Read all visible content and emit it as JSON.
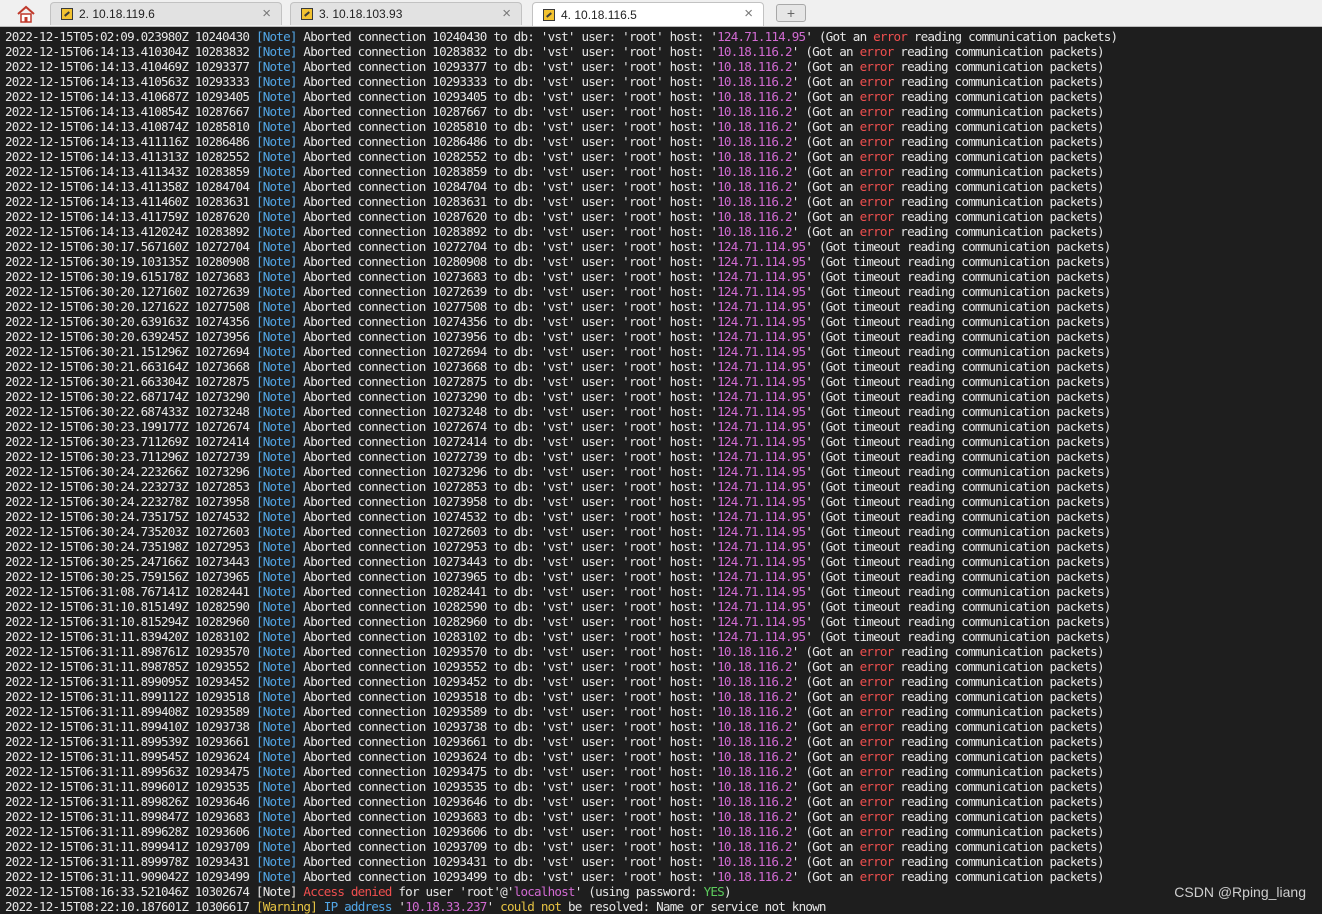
{
  "tabs": [
    {
      "label": "2. 10.18.119.6",
      "active": false
    },
    {
      "label": "3. 10.18.103.93",
      "active": false
    },
    {
      "label": "4. 10.18.116.5",
      "active": true
    }
  ],
  "tab_close_glyph": "×",
  "new_tab_glyph": "+",
  "icons": {
    "home": "home-icon",
    "session": "terminal-session-icon",
    "new_tab": "plus-icon"
  },
  "colors": {
    "background": "#1e1e1e",
    "text": "#e6e6e6",
    "note": "#52a7e8",
    "host": "#d16ad2",
    "error": "#ef4f4f",
    "warning": "#e6c343",
    "yes": "#5ccc5c"
  },
  "log": [
    [
      "2022-12-15T05:02:09.023980Z 10240430 ",
      [
        "n",
        "[Note]"
      ],
      " Aborted connection 10240430 to db: 'vst' user: 'root' host: '",
      [
        "h",
        "124.71.114.95"
      ],
      "' (Got an ",
      [
        "e",
        "error"
      ],
      " reading communication packets)"
    ],
    [
      "2022-12-15T06:14:13.410304Z 10283832 ",
      [
        "n",
        "[Note]"
      ],
      " Aborted connection 10283832 to db: 'vst' user: 'root' host: '",
      [
        "h",
        "10.18.116.2"
      ],
      "' (Got an ",
      [
        "e",
        "error"
      ],
      " reading communication packets)"
    ],
    [
      "2022-12-15T06:14:13.410469Z 10293377 ",
      [
        "n",
        "[Note]"
      ],
      " Aborted connection 10293377 to db: 'vst' user: 'root' host: '",
      [
        "h",
        "10.18.116.2"
      ],
      "' (Got an ",
      [
        "e",
        "error"
      ],
      " reading communication packets)"
    ],
    [
      "2022-12-15T06:14:13.410563Z 10293333 ",
      [
        "n",
        "[Note]"
      ],
      " Aborted connection 10293333 to db: 'vst' user: 'root' host: '",
      [
        "h",
        "10.18.116.2"
      ],
      "' (Got an ",
      [
        "e",
        "error"
      ],
      " reading communication packets)"
    ],
    [
      "2022-12-15T06:14:13.410687Z 10293405 ",
      [
        "n",
        "[Note]"
      ],
      " Aborted connection 10293405 to db: 'vst' user: 'root' host: '",
      [
        "h",
        "10.18.116.2"
      ],
      "' (Got an ",
      [
        "e",
        "error"
      ],
      " reading communication packets)"
    ],
    [
      "2022-12-15T06:14:13.410854Z 10287667 ",
      [
        "n",
        "[Note]"
      ],
      " Aborted connection 10287667 to db: 'vst' user: 'root' host: '",
      [
        "h",
        "10.18.116.2"
      ],
      "' (Got an ",
      [
        "e",
        "error"
      ],
      " reading communication packets)"
    ],
    [
      "2022-12-15T06:14:13.410874Z 10285810 ",
      [
        "n",
        "[Note]"
      ],
      " Aborted connection 10285810 to db: 'vst' user: 'root' host: '",
      [
        "h",
        "10.18.116.2"
      ],
      "' (Got an ",
      [
        "e",
        "error"
      ],
      " reading communication packets)"
    ],
    [
      "2022-12-15T06:14:13.411116Z 10286486 ",
      [
        "n",
        "[Note]"
      ],
      " Aborted connection 10286486 to db: 'vst' user: 'root' host: '",
      [
        "h",
        "10.18.116.2"
      ],
      "' (Got an ",
      [
        "e",
        "error"
      ],
      " reading communication packets)"
    ],
    [
      "2022-12-15T06:14:13.411313Z 10282552 ",
      [
        "n",
        "[Note]"
      ],
      " Aborted connection 10282552 to db: 'vst' user: 'root' host: '",
      [
        "h",
        "10.18.116.2"
      ],
      "' (Got an ",
      [
        "e",
        "error"
      ],
      " reading communication packets)"
    ],
    [
      "2022-12-15T06:14:13.411343Z 10283859 ",
      [
        "n",
        "[Note]"
      ],
      " Aborted connection 10283859 to db: 'vst' user: 'root' host: '",
      [
        "h",
        "10.18.116.2"
      ],
      "' (Got an ",
      [
        "e",
        "error"
      ],
      " reading communication packets)"
    ],
    [
      "2022-12-15T06:14:13.411358Z 10284704 ",
      [
        "n",
        "[Note]"
      ],
      " Aborted connection 10284704 to db: 'vst' user: 'root' host: '",
      [
        "h",
        "10.18.116.2"
      ],
      "' (Got an ",
      [
        "e",
        "error"
      ],
      " reading communication packets)"
    ],
    [
      "2022-12-15T06:14:13.411460Z 10283631 ",
      [
        "n",
        "[Note]"
      ],
      " Aborted connection 10283631 to db: 'vst' user: 'root' host: '",
      [
        "h",
        "10.18.116.2"
      ],
      "' (Got an ",
      [
        "e",
        "error"
      ],
      " reading communication packets)"
    ],
    [
      "2022-12-15T06:14:13.411759Z 10287620 ",
      [
        "n",
        "[Note]"
      ],
      " Aborted connection 10287620 to db: 'vst' user: 'root' host: '",
      [
        "h",
        "10.18.116.2"
      ],
      "' (Got an ",
      [
        "e",
        "error"
      ],
      " reading communication packets)"
    ],
    [
      "2022-12-15T06:14:13.412024Z 10283892 ",
      [
        "n",
        "[Note]"
      ],
      " Aborted connection 10283892 to db: 'vst' user: 'root' host: '",
      [
        "h",
        "10.18.116.2"
      ],
      "' (Got an ",
      [
        "e",
        "error"
      ],
      " reading communication packets)"
    ],
    [
      "2022-12-15T06:30:17.567160Z 10272704 ",
      [
        "n",
        "[Note]"
      ],
      " Aborted connection 10272704 to db: 'vst' user: 'root' host: '",
      [
        "h",
        "124.71.114.95"
      ],
      "' (Got timeout reading communication packets)"
    ],
    [
      "2022-12-15T06:30:19.103135Z 10280908 ",
      [
        "n",
        "[Note]"
      ],
      " Aborted connection 10280908 to db: 'vst' user: 'root' host: '",
      [
        "h",
        "124.71.114.95"
      ],
      "' (Got timeout reading communication packets)"
    ],
    [
      "2022-12-15T06:30:19.615178Z 10273683 ",
      [
        "n",
        "[Note]"
      ],
      " Aborted connection 10273683 to db: 'vst' user: 'root' host: '",
      [
        "h",
        "124.71.114.95"
      ],
      "' (Got timeout reading communication packets)"
    ],
    [
      "2022-12-15T06:30:20.127160Z 10272639 ",
      [
        "n",
        "[Note]"
      ],
      " Aborted connection 10272639 to db: 'vst' user: 'root' host: '",
      [
        "h",
        "124.71.114.95"
      ],
      "' (Got timeout reading communication packets)"
    ],
    [
      "2022-12-15T06:30:20.127162Z 10277508 ",
      [
        "n",
        "[Note]"
      ],
      " Aborted connection 10277508 to db: 'vst' user: 'root' host: '",
      [
        "h",
        "124.71.114.95"
      ],
      "' (Got timeout reading communication packets)"
    ],
    [
      "2022-12-15T06:30:20.639163Z 10274356 ",
      [
        "n",
        "[Note]"
      ],
      " Aborted connection 10274356 to db: 'vst' user: 'root' host: '",
      [
        "h",
        "124.71.114.95"
      ],
      "' (Got timeout reading communication packets)"
    ],
    [
      "2022-12-15T06:30:20.639245Z 10273956 ",
      [
        "n",
        "[Note]"
      ],
      " Aborted connection 10273956 to db: 'vst' user: 'root' host: '",
      [
        "h",
        "124.71.114.95"
      ],
      "' (Got timeout reading communication packets)"
    ],
    [
      "2022-12-15T06:30:21.151296Z 10272694 ",
      [
        "n",
        "[Note]"
      ],
      " Aborted connection 10272694 to db: 'vst' user: 'root' host: '",
      [
        "h",
        "124.71.114.95"
      ],
      "' (Got timeout reading communication packets)"
    ],
    [
      "2022-12-15T06:30:21.663164Z 10273668 ",
      [
        "n",
        "[Note]"
      ],
      " Aborted connection 10273668 to db: 'vst' user: 'root' host: '",
      [
        "h",
        "124.71.114.95"
      ],
      "' (Got timeout reading communication packets)"
    ],
    [
      "2022-12-15T06:30:21.663304Z 10272875 ",
      [
        "n",
        "[Note]"
      ],
      " Aborted connection 10272875 to db: 'vst' user: 'root' host: '",
      [
        "h",
        "124.71.114.95"
      ],
      "' (Got timeout reading communication packets)"
    ],
    [
      "2022-12-15T06:30:22.687174Z 10273290 ",
      [
        "n",
        "[Note]"
      ],
      " Aborted connection 10273290 to db: 'vst' user: 'root' host: '",
      [
        "h",
        "124.71.114.95"
      ],
      "' (Got timeout reading communication packets)"
    ],
    [
      "2022-12-15T06:30:22.687433Z 10273248 ",
      [
        "n",
        "[Note]"
      ],
      " Aborted connection 10273248 to db: 'vst' user: 'root' host: '",
      [
        "h",
        "124.71.114.95"
      ],
      "' (Got timeout reading communication packets)"
    ],
    [
      "2022-12-15T06:30:23.199177Z 10272674 ",
      [
        "n",
        "[Note]"
      ],
      " Aborted connection 10272674 to db: 'vst' user: 'root' host: '",
      [
        "h",
        "124.71.114.95"
      ],
      "' (Got timeout reading communication packets)"
    ],
    [
      "2022-12-15T06:30:23.711269Z 10272414 ",
      [
        "n",
        "[Note]"
      ],
      " Aborted connection 10272414 to db: 'vst' user: 'root' host: '",
      [
        "h",
        "124.71.114.95"
      ],
      "' (Got timeout reading communication packets)"
    ],
    [
      "2022-12-15T06:30:23.711296Z 10272739 ",
      [
        "n",
        "[Note]"
      ],
      " Aborted connection 10272739 to db: 'vst' user: 'root' host: '",
      [
        "h",
        "124.71.114.95"
      ],
      "' (Got timeout reading communication packets)"
    ],
    [
      "2022-12-15T06:30:24.223266Z 10273296 ",
      [
        "n",
        "[Note]"
      ],
      " Aborted connection 10273296 to db: 'vst' user: 'root' host: '",
      [
        "h",
        "124.71.114.95"
      ],
      "' (Got timeout reading communication packets)"
    ],
    [
      "2022-12-15T06:30:24.223273Z 10272853 ",
      [
        "n",
        "[Note]"
      ],
      " Aborted connection 10272853 to db: 'vst' user: 'root' host: '",
      [
        "h",
        "124.71.114.95"
      ],
      "' (Got timeout reading communication packets)"
    ],
    [
      "2022-12-15T06:30:24.223278Z 10273958 ",
      [
        "n",
        "[Note]"
      ],
      " Aborted connection 10273958 to db: 'vst' user: 'root' host: '",
      [
        "h",
        "124.71.114.95"
      ],
      "' (Got timeout reading communication packets)"
    ],
    [
      "2022-12-15T06:30:24.735175Z 10274532 ",
      [
        "n",
        "[Note]"
      ],
      " Aborted connection 10274532 to db: 'vst' user: 'root' host: '",
      [
        "h",
        "124.71.114.95"
      ],
      "' (Got timeout reading communication packets)"
    ],
    [
      "2022-12-15T06:30:24.735203Z 10272603 ",
      [
        "n",
        "[Note]"
      ],
      " Aborted connection 10272603 to db: 'vst' user: 'root' host: '",
      [
        "h",
        "124.71.114.95"
      ],
      "' (Got timeout reading communication packets)"
    ],
    [
      "2022-12-15T06:30:24.735198Z 10272953 ",
      [
        "n",
        "[Note]"
      ],
      " Aborted connection 10272953 to db: 'vst' user: 'root' host: '",
      [
        "h",
        "124.71.114.95"
      ],
      "' (Got timeout reading communication packets)"
    ],
    [
      "2022-12-15T06:30:25.247166Z 10273443 ",
      [
        "n",
        "[Note]"
      ],
      " Aborted connection 10273443 to db: 'vst' user: 'root' host: '",
      [
        "h",
        "124.71.114.95"
      ],
      "' (Got timeout reading communication packets)"
    ],
    [
      "2022-12-15T06:30:25.759156Z 10273965 ",
      [
        "n",
        "[Note]"
      ],
      " Aborted connection 10273965 to db: 'vst' user: 'root' host: '",
      [
        "h",
        "124.71.114.95"
      ],
      "' (Got timeout reading communication packets)"
    ],
    [
      "2022-12-15T06:31:08.767141Z 10282441 ",
      [
        "n",
        "[Note]"
      ],
      " Aborted connection 10282441 to db: 'vst' user: 'root' host: '",
      [
        "h",
        "124.71.114.95"
      ],
      "' (Got timeout reading communication packets)"
    ],
    [
      "2022-12-15T06:31:10.815149Z 10282590 ",
      [
        "n",
        "[Note]"
      ],
      " Aborted connection 10282590 to db: 'vst' user: 'root' host: '",
      [
        "h",
        "124.71.114.95"
      ],
      "' (Got timeout reading communication packets)"
    ],
    [
      "2022-12-15T06:31:10.815294Z 10282960 ",
      [
        "n",
        "[Note]"
      ],
      " Aborted connection 10282960 to db: 'vst' user: 'root' host: '",
      [
        "h",
        "124.71.114.95"
      ],
      "' (Got timeout reading communication packets)"
    ],
    [
      "2022-12-15T06:31:11.839420Z 10283102 ",
      [
        "n",
        "[Note]"
      ],
      " Aborted connection 10283102 to db: 'vst' user: 'root' host: '",
      [
        "h",
        "124.71.114.95"
      ],
      "' (Got timeout reading communication packets)"
    ],
    [
      "2022-12-15T06:31:11.898761Z 10293570 ",
      [
        "n",
        "[Note]"
      ],
      " Aborted connection 10293570 to db: 'vst' user: 'root' host: '",
      [
        "h",
        "10.18.116.2"
      ],
      "' (Got an ",
      [
        "e",
        "error"
      ],
      " reading communication packets)"
    ],
    [
      "2022-12-15T06:31:11.898785Z 10293552 ",
      [
        "n",
        "[Note]"
      ],
      " Aborted connection 10293552 to db: 'vst' user: 'root' host: '",
      [
        "h",
        "10.18.116.2"
      ],
      "' (Got an ",
      [
        "e",
        "error"
      ],
      " reading communication packets)"
    ],
    [
      "2022-12-15T06:31:11.899095Z 10293452 ",
      [
        "n",
        "[Note]"
      ],
      " Aborted connection 10293452 to db: 'vst' user: 'root' host: '",
      [
        "h",
        "10.18.116.2"
      ],
      "' (Got an ",
      [
        "e",
        "error"
      ],
      " reading communication packets)"
    ],
    [
      "2022-12-15T06:31:11.899112Z 10293518 ",
      [
        "n",
        "[Note]"
      ],
      " Aborted connection 10293518 to db: 'vst' user: 'root' host: '",
      [
        "h",
        "10.18.116.2"
      ],
      "' (Got an ",
      [
        "e",
        "error"
      ],
      " reading communication packets)"
    ],
    [
      "2022-12-15T06:31:11.899408Z 10293589 ",
      [
        "n",
        "[Note]"
      ],
      " Aborted connection 10293589 to db: 'vst' user: 'root' host: '",
      [
        "h",
        "10.18.116.2"
      ],
      "' (Got an ",
      [
        "e",
        "error"
      ],
      " reading communication packets)"
    ],
    [
      "2022-12-15T06:31:11.899410Z 10293738 ",
      [
        "n",
        "[Note]"
      ],
      " Aborted connection 10293738 to db: 'vst' user: 'root' host: '",
      [
        "h",
        "10.18.116.2"
      ],
      "' (Got an ",
      [
        "e",
        "error"
      ],
      " reading communication packets)"
    ],
    [
      "2022-12-15T06:31:11.899539Z 10293661 ",
      [
        "n",
        "[Note]"
      ],
      " Aborted connection 10293661 to db: 'vst' user: 'root' host: '",
      [
        "h",
        "10.18.116.2"
      ],
      "' (Got an ",
      [
        "e",
        "error"
      ],
      " reading communication packets)"
    ],
    [
      "2022-12-15T06:31:11.899545Z 10293624 ",
      [
        "n",
        "[Note]"
      ],
      " Aborted connection 10293624 to db: 'vst' user: 'root' host: '",
      [
        "h",
        "10.18.116.2"
      ],
      "' (Got an ",
      [
        "e",
        "error"
      ],
      " reading communication packets)"
    ],
    [
      "2022-12-15T06:31:11.899563Z 10293475 ",
      [
        "n",
        "[Note]"
      ],
      " Aborted connection 10293475 to db: 'vst' user: 'root' host: '",
      [
        "h",
        "10.18.116.2"
      ],
      "' (Got an ",
      [
        "e",
        "error"
      ],
      " reading communication packets)"
    ],
    [
      "2022-12-15T06:31:11.899601Z 10293535 ",
      [
        "n",
        "[Note]"
      ],
      " Aborted connection 10293535 to db: 'vst' user: 'root' host: '",
      [
        "h",
        "10.18.116.2"
      ],
      "' (Got an ",
      [
        "e",
        "error"
      ],
      " reading communication packets)"
    ],
    [
      "2022-12-15T06:31:11.899826Z 10293646 ",
      [
        "n",
        "[Note]"
      ],
      " Aborted connection 10293646 to db: 'vst' user: 'root' host: '",
      [
        "h",
        "10.18.116.2"
      ],
      "' (Got an ",
      [
        "e",
        "error"
      ],
      " reading communication packets)"
    ],
    [
      "2022-12-15T06:31:11.899847Z 10293683 ",
      [
        "n",
        "[Note]"
      ],
      " Aborted connection 10293683 to db: 'vst' user: 'root' host: '",
      [
        "h",
        "10.18.116.2"
      ],
      "' (Got an ",
      [
        "e",
        "error"
      ],
      " reading communication packets)"
    ],
    [
      "2022-12-15T06:31:11.899628Z 10293606 ",
      [
        "n",
        "[Note]"
      ],
      " Aborted connection 10293606 to db: 'vst' user: 'root' host: '",
      [
        "h",
        "10.18.116.2"
      ],
      "' (Got an ",
      [
        "e",
        "error"
      ],
      " reading communication packets)"
    ],
    [
      "2022-12-15T06:31:11.899941Z 10293709 ",
      [
        "n",
        "[Note]"
      ],
      " Aborted connection 10293709 to db: 'vst' user: 'root' host: '",
      [
        "h",
        "10.18.116.2"
      ],
      "' (Got an ",
      [
        "e",
        "error"
      ],
      " reading communication packets)"
    ],
    [
      "2022-12-15T06:31:11.899978Z 10293431 ",
      [
        "n",
        "[Note]"
      ],
      " Aborted connection 10293431 to db: 'vst' user: 'root' host: '",
      [
        "h",
        "10.18.116.2"
      ],
      "' (Got an ",
      [
        "e",
        "error"
      ],
      " reading communication packets)"
    ],
    [
      "2022-12-15T06:31:11.909042Z 10293499 ",
      [
        "n",
        "[Note]"
      ],
      " Aborted connection 10293499 to db: 'vst' user: 'root' host: '",
      [
        "h",
        "10.18.116.2"
      ],
      "' (Got an ",
      [
        "e",
        "error"
      ],
      " reading communication packets)"
    ],
    [
      "2022-12-15T08:16:33.521046Z 10302674 [Note] ",
      [
        "e",
        "Access denied"
      ],
      " for user 'root'@'",
      [
        "h",
        "localhost"
      ],
      "' (using password: ",
      [
        "y",
        "YES"
      ],
      ")"
    ],
    [
      "2022-12-15T08:22:10.187601Z 10306617 ",
      [
        "w",
        "[Warning]"
      ],
      " ",
      [
        "i",
        "IP address"
      ],
      " '",
      [
        "h",
        "10.18.33.237"
      ],
      "' ",
      [
        "w",
        "could not"
      ],
      " be resolved: Name or service not known"
    ]
  ],
  "watermark": "CSDN @Rping_liang"
}
